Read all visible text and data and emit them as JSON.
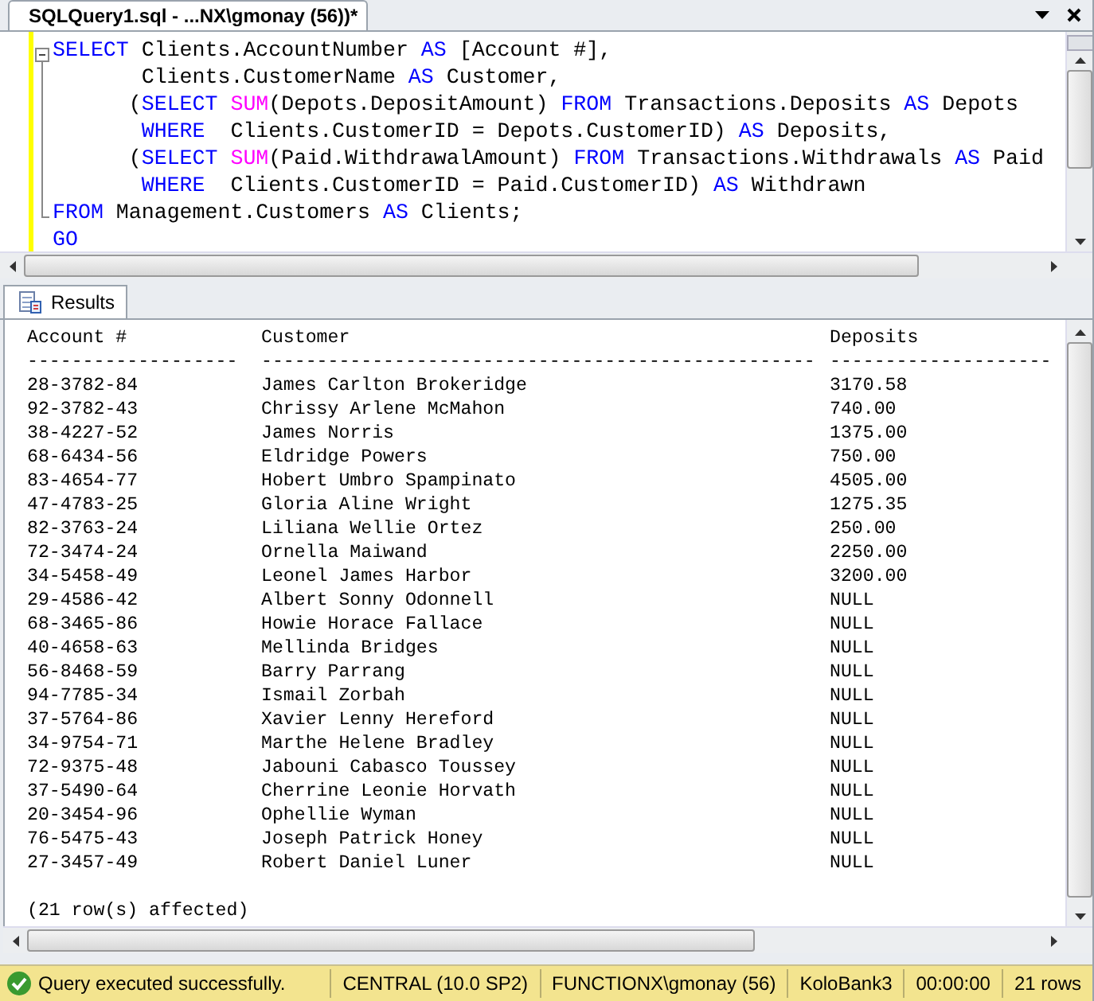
{
  "document_tab": {
    "title": "SQLQuery1.sql - ...NX\\gmonay (56))*",
    "selected": true
  },
  "editor": {
    "lines": [
      {
        "kind": "clause",
        "tokens": [
          {
            "kind": "keyword",
            "t": "SELECT"
          },
          {
            "kind": "text",
            "t": " Clients.AccountNumber "
          },
          {
            "kind": "keyword",
            "t": "AS"
          },
          {
            "kind": "text",
            "t": " [Account #],"
          }
        ]
      },
      {
        "kind": "continuation",
        "tokens": [
          {
            "kind": "text",
            "t": "Clients.CustomerName "
          },
          {
            "kind": "keyword",
            "t": "AS"
          },
          {
            "kind": "text",
            "t": " Customer,"
          }
        ]
      },
      {
        "kind": "subquery",
        "tokens": [
          {
            "kind": "text",
            "t": "("
          },
          {
            "kind": "keyword",
            "t": "SELECT "
          },
          {
            "kind": "function",
            "t": "SUM"
          },
          {
            "kind": "text",
            "t": "(Depots.DepositAmount) "
          },
          {
            "kind": "keyword",
            "t": "FROM"
          },
          {
            "kind": "text",
            "t": " Transactions.Deposits "
          },
          {
            "kind": "keyword",
            "t": "AS"
          },
          {
            "kind": "text",
            "t": " Depots"
          }
        ]
      },
      {
        "kind": "continuation",
        "tokens": [
          {
            "kind": "keyword",
            "t": "WHERE"
          },
          {
            "kind": "text",
            "t": "  Clients.CustomerID = Depots.CustomerID) "
          },
          {
            "kind": "keyword",
            "t": "AS"
          },
          {
            "kind": "text",
            "t": " Deposits,"
          }
        ]
      },
      {
        "kind": "subquery",
        "tokens": [
          {
            "kind": "text",
            "t": "("
          },
          {
            "kind": "keyword",
            "t": "SELECT "
          },
          {
            "kind": "function",
            "t": "SUM"
          },
          {
            "kind": "text",
            "t": "(Paid.WithdrawalAmount) "
          },
          {
            "kind": "keyword",
            "t": "FROM"
          },
          {
            "kind": "text",
            "t": " Transactions.Withdrawals "
          },
          {
            "kind": "keyword",
            "t": "AS"
          },
          {
            "kind": "text",
            "t": " Paid"
          }
        ]
      },
      {
        "kind": "continuation",
        "tokens": [
          {
            "kind": "keyword",
            "t": "WHERE"
          },
          {
            "kind": "text",
            "t": "  Clients.CustomerID = Paid.CustomerID) "
          },
          {
            "kind": "keyword",
            "t": "AS"
          },
          {
            "kind": "text",
            "t": " Withdrawn"
          }
        ]
      },
      {
        "kind": "clause",
        "tokens": [
          {
            "kind": "keyword",
            "t": "FROM"
          },
          {
            "kind": "text",
            "t": " Management.Customers "
          },
          {
            "kind": "keyword",
            "t": "AS"
          },
          {
            "kind": "text",
            "t": " Clients;"
          }
        ]
      },
      {
        "kind": "clause",
        "tokens": [
          {
            "kind": "keyword",
            "t": "GO"
          }
        ]
      }
    ]
  },
  "results_tab": {
    "label": "Results",
    "selected": true
  },
  "results": {
    "columns": [
      {
        "header": "Account #",
        "rule": "-------------------"
      },
      {
        "header": "Customer",
        "rule": "--------------------------------------------------"
      },
      {
        "header": "Deposits",
        "rule": "--------------------"
      }
    ],
    "rows": [
      [
        "28-3782-84",
        "James Carlton Brokeridge",
        "3170.58"
      ],
      [
        "92-3782-43",
        "Chrissy Arlene McMahon",
        "740.00"
      ],
      [
        "38-4227-52",
        "James Norris",
        "1375.00"
      ],
      [
        "68-6434-56",
        "Eldridge Powers",
        "750.00"
      ],
      [
        "83-4654-77",
        "Hobert Umbro Spampinato",
        "4505.00"
      ],
      [
        "47-4783-25",
        "Gloria Aline Wright",
        "1275.35"
      ],
      [
        "82-3763-24",
        "Liliana Wellie Ortez",
        "250.00"
      ],
      [
        "72-3474-24",
        "Ornella Maiwand",
        "2250.00"
      ],
      [
        "34-5458-49",
        "Leonel James Harbor",
        "3200.00"
      ],
      [
        "29-4586-42",
        "Albert Sonny Odonnell",
        "NULL"
      ],
      [
        "68-3465-86",
        "Howie Horace Fallace",
        "NULL"
      ],
      [
        "40-4658-63",
        "Mellinda Bridges",
        "NULL"
      ],
      [
        "56-8468-59",
        "Barry Parrang",
        "NULL"
      ],
      [
        "94-7785-34",
        "Ismail Zorbah",
        "NULL"
      ],
      [
        "37-5764-86",
        "Xavier Lenny Hereford",
        "NULL"
      ],
      [
        "34-9754-71",
        "Marthe Helene Bradley",
        "NULL"
      ],
      [
        "72-9375-48",
        "Jabouni Cabasco Toussey",
        "NULL"
      ],
      [
        "37-5490-64",
        "Cherrine Leonie Horvath",
        "NULL"
      ],
      [
        "20-3454-96",
        "Ophellie Wyman",
        "NULL"
      ],
      [
        "76-5475-43",
        "Joseph Patrick Honey",
        "NULL"
      ],
      [
        "27-3457-49",
        "Robert Daniel Luner",
        "NULL"
      ]
    ],
    "footer": "(21 row(s) affected)"
  },
  "status_bar": {
    "message": "Query executed successfully.",
    "server": "CENTRAL (10.0 SP2)",
    "user": "FUNCTIONX\\gmonay (56)",
    "database": "KoloBank3",
    "elapsed": "00:00:00",
    "row_count": "21 rows"
  }
}
